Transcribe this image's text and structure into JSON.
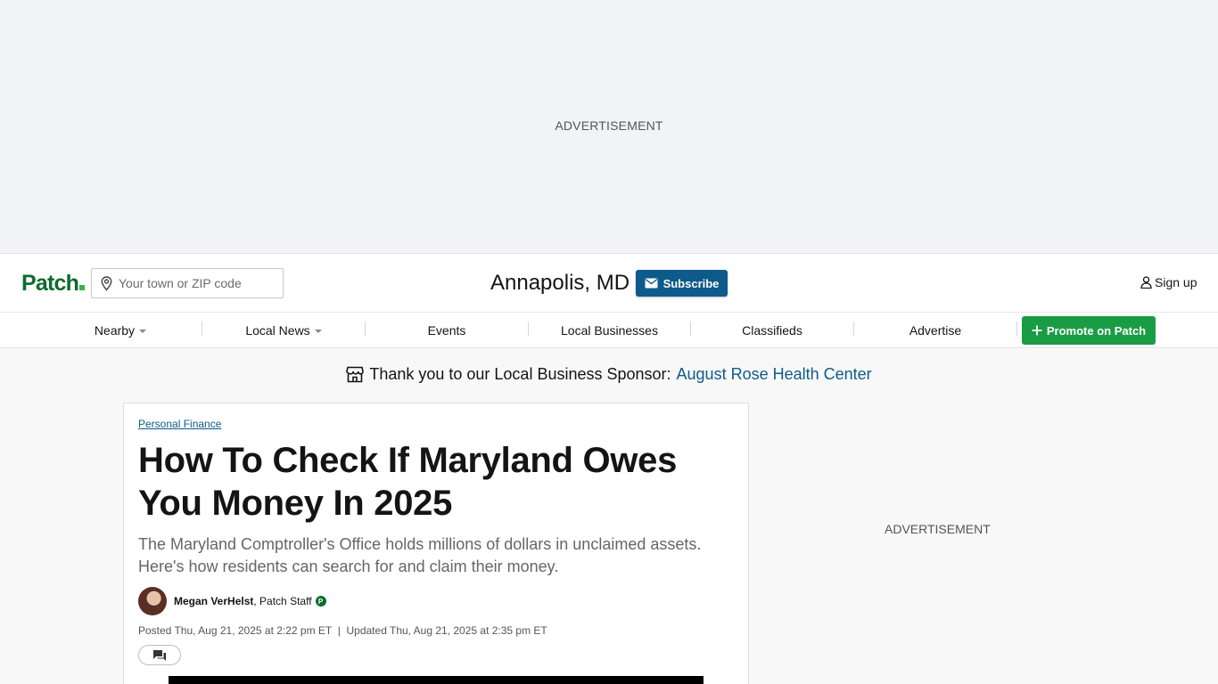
{
  "top_ad": {
    "label": "ADVERTISEMENT"
  },
  "header": {
    "logo": "Patch",
    "search": {
      "placeholder": "Your town or ZIP code",
      "value": ""
    },
    "town": "Annapolis, MD",
    "subscribe_label": "Subscribe",
    "signup_label": "Sign up",
    "icons": {
      "location": "map-pin-icon",
      "mail": "mail-icon",
      "user": "user-icon"
    }
  },
  "nav": {
    "items": [
      {
        "label": "Nearby",
        "dropdown": true
      },
      {
        "label": "Local News",
        "dropdown": true
      },
      {
        "label": "Events",
        "dropdown": false
      },
      {
        "label": "Local Businesses",
        "dropdown": false
      },
      {
        "label": "Classifieds",
        "dropdown": false
      },
      {
        "label": "Advertise",
        "dropdown": false
      }
    ],
    "promote_label": "Promote on Patch"
  },
  "sponsor": {
    "text": "Thank you to our Local Business Sponsor:",
    "name": "August Rose Health Center",
    "icon": "storefront-icon"
  },
  "article": {
    "category": "Personal Finance",
    "headline": "How To Check If Maryland Owes You Money In 2025",
    "dek": "The Maryland Comptroller's Office holds millions of dollars in unclaimed assets. Here's how residents can search for and claim their money.",
    "author": "Megan VerHelst",
    "author_role": ", Patch Staff",
    "badge": "P",
    "dates": "Posted Thu, Aug 21, 2025 at 2:22 pm ET  |  Updated Thu, Aug 21, 2025 at 2:35 pm ET"
  },
  "side_ad": {
    "label": "ADVERTISEMENT"
  },
  "colors": {
    "brand_green": "#0c6b2e",
    "subscribe_blue": "#0e5a8a",
    "promote_green": "#1a9c45"
  }
}
